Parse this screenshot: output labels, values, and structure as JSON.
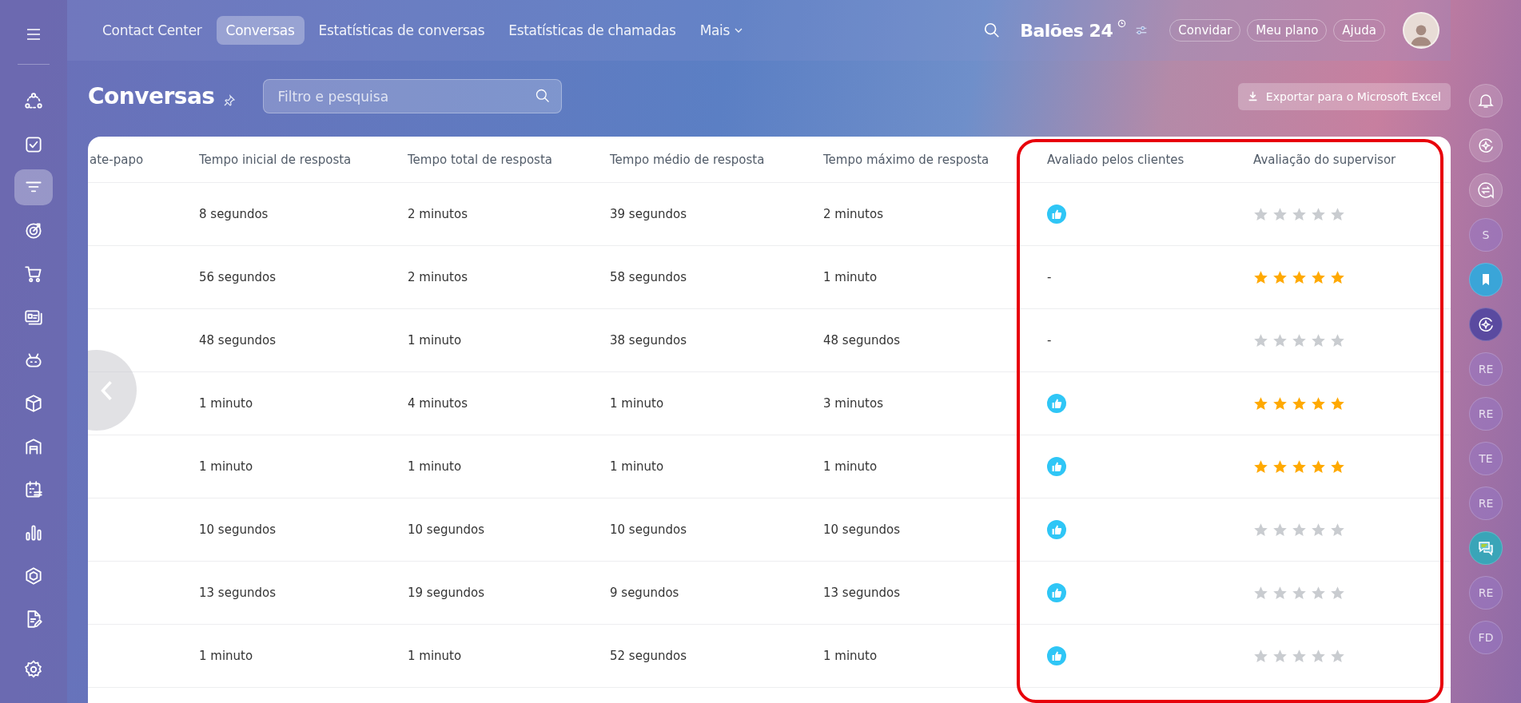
{
  "nav": {
    "tabs": [
      {
        "label": "Contact Center",
        "selected": false
      },
      {
        "label": "Conversas",
        "selected": true
      },
      {
        "label": "Estatísticas de conversas",
        "selected": false
      },
      {
        "label": "Estatísticas de chamadas",
        "selected": false
      },
      {
        "label": "Mais",
        "selected": false,
        "dropdown": true
      }
    ],
    "company": "Balões 24",
    "buttons": [
      "Convidar",
      "Meu plano",
      "Ajuda"
    ]
  },
  "sidebar": {
    "items": [
      {
        "kind": "network",
        "selected": false
      },
      {
        "kind": "task",
        "selected": false
      },
      {
        "kind": "funnel",
        "selected": true
      },
      {
        "kind": "target",
        "selected": false
      },
      {
        "kind": "cart",
        "selected": false
      },
      {
        "kind": "card",
        "selected": false
      },
      {
        "kind": "robot",
        "selected": false
      },
      {
        "kind": "box",
        "selected": false
      },
      {
        "kind": "garage",
        "selected": false
      },
      {
        "kind": "calendar",
        "selected": false
      },
      {
        "kind": "chart",
        "selected": false
      },
      {
        "kind": "hexagon",
        "selected": false
      },
      {
        "kind": "document",
        "selected": false
      }
    ]
  },
  "page": {
    "title": "Conversas",
    "search": {
      "placeholder": "Filtro e pesquisa"
    },
    "export_button": "Exportar para o Microsoft Excel"
  },
  "table": {
    "columns": [
      "ate-papo",
      "Tempo inicial de resposta",
      "Tempo total de resposta",
      "Tempo médio de resposta",
      "Tempo máximo de resposta",
      "Avaliado pelos clientes",
      "Avaliação do supervisor"
    ],
    "rows": [
      {
        "initial": "8 segundos",
        "total": "2 minutos",
        "average": "39 segundos",
        "max": "2 minutos",
        "customer": {
          "kind": "like"
        },
        "stars": 0
      },
      {
        "initial": "56 segundos",
        "total": "2 minutos",
        "average": "58 segundos",
        "max": "1 minuto",
        "customer": {
          "kind": "none",
          "text": "-"
        },
        "stars": 5
      },
      {
        "initial": "48 segundos",
        "total": "1 minuto",
        "average": "38 segundos",
        "max": "48 segundos",
        "customer": {
          "kind": "none",
          "text": "-"
        },
        "stars": 0
      },
      {
        "initial": "1 minuto",
        "total": "4 minutos",
        "average": "1 minuto",
        "max": "3 minutos",
        "customer": {
          "kind": "like"
        },
        "stars": 5
      },
      {
        "initial": "1 minuto",
        "total": "1 minuto",
        "average": "1 minuto",
        "max": "1 minuto",
        "customer": {
          "kind": "like"
        },
        "stars": 5
      },
      {
        "initial": "10 segundos",
        "total": "10 segundos",
        "average": "10 segundos",
        "max": "10 segundos",
        "customer": {
          "kind": "like"
        },
        "stars": 0
      },
      {
        "initial": "13 segundos",
        "total": "19 segundos",
        "average": "9 segundos",
        "max": "13 segundos",
        "customer": {
          "kind": "like"
        },
        "stars": 0
      },
      {
        "initial": "1 minuto",
        "total": "1 minuto",
        "average": "52 segundos",
        "max": "1 minuto",
        "customer": {
          "kind": "like"
        },
        "stars": 0
      }
    ]
  },
  "right_panel": {
    "items": [
      {
        "kind": "bell"
      },
      {
        "kind": "sparkle"
      },
      {
        "kind": "exchange"
      },
      {
        "kind": "avatar",
        "text": "S"
      },
      {
        "kind": "bookmark"
      },
      {
        "kind": "sparkle-dark"
      },
      {
        "kind": "avatar",
        "text": "RE"
      },
      {
        "kind": "avatar",
        "text": "RE"
      },
      {
        "kind": "avatar",
        "text": "TE"
      },
      {
        "kind": "avatar",
        "text": "RE"
      },
      {
        "kind": "chat"
      },
      {
        "kind": "avatar",
        "text": "RE"
      },
      {
        "kind": "avatar",
        "text": "FD"
      }
    ]
  }
}
